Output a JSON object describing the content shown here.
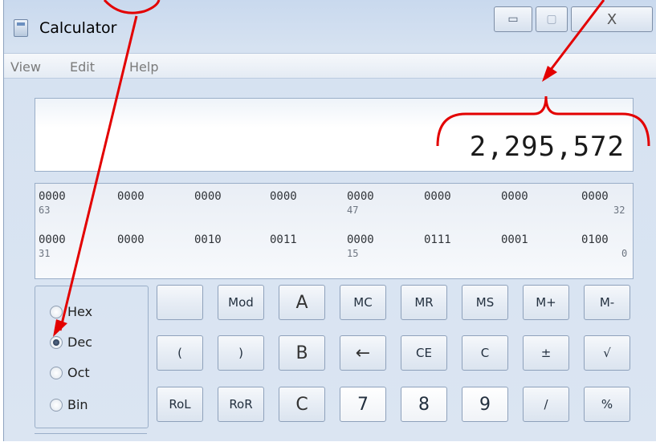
{
  "window": {
    "title": "Calculator"
  },
  "caption_buttons": {
    "minimize": "▭",
    "maximize": "▢",
    "close": "X"
  },
  "menu": [
    "View",
    "Edit",
    "Help"
  ],
  "display": {
    "value": "2,295,572"
  },
  "bits": {
    "row1": [
      "0000",
      "0000",
      "0000",
      "0000",
      "0000",
      "0000",
      "0000",
      "0000"
    ],
    "row1_positions": [
      "63",
      "47",
      "32"
    ],
    "row2": [
      "0000",
      "0000",
      "0010",
      "0011",
      "0000",
      "0111",
      "0001",
      "0100"
    ],
    "row2_positions": [
      "31",
      "15",
      "0"
    ]
  },
  "radix": [
    {
      "label": "Hex",
      "checked": false
    },
    {
      "label": "Dec",
      "checked": true
    },
    {
      "label": "Oct",
      "checked": false
    },
    {
      "label": "Bin",
      "checked": false
    }
  ],
  "keys": {
    "r1": [
      "",
      "Mod",
      "A",
      "MC",
      "MR",
      "MS",
      "M+",
      "M-"
    ],
    "r2": [
      "(",
      ")",
      "B",
      "←",
      "CE",
      "C",
      "±",
      "√"
    ],
    "r3": [
      "RoL",
      "RoR",
      "C",
      "7",
      "8",
      "9",
      "/",
      "%"
    ]
  },
  "annotation_color": "#e30000"
}
